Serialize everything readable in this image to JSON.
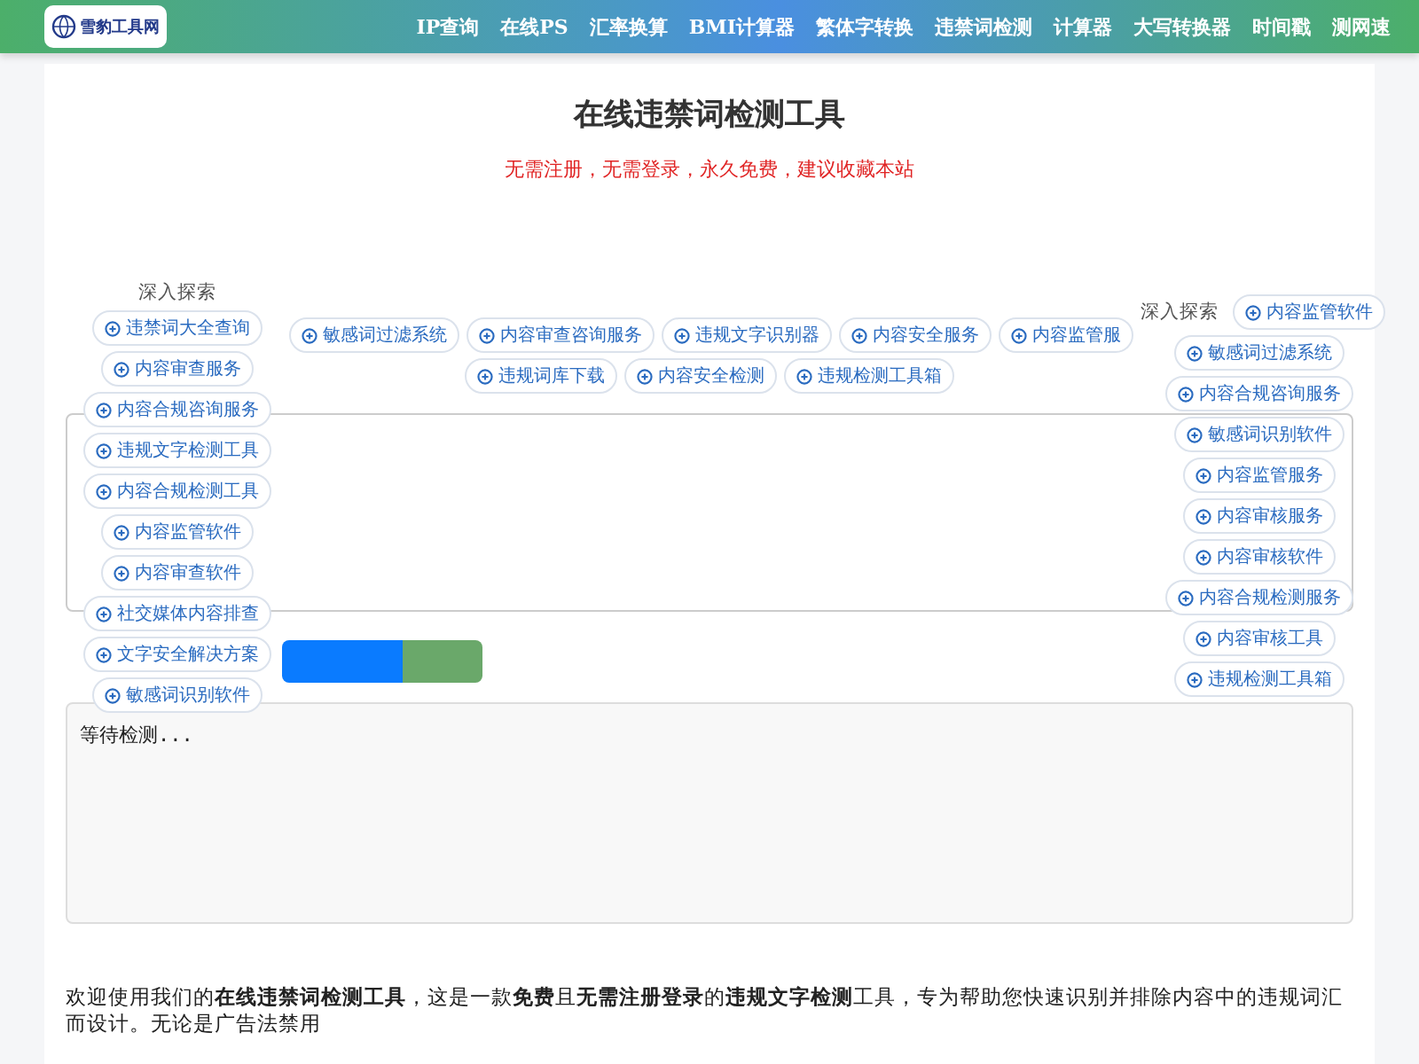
{
  "header": {
    "logo_text": "雪豹工具网",
    "nav": [
      "IP查询",
      "在线PS",
      "汇率换算",
      "BMI计算器",
      "繁体字转换",
      "违禁词检测",
      "计算器",
      "大写转换器",
      "时间戳",
      "测网速"
    ]
  },
  "title": "在线违禁词检测工具",
  "subtitle": "无需注册，无需登录，永久免费，建议收藏本站",
  "tag_rows": [
    [
      "敏感词过滤系统",
      "内容审查咨询服务",
      "违规文字识别器",
      "内容安全服务",
      "内容监管服"
    ],
    [
      "违规词库下载",
      "内容安全检测",
      "违规检测工具箱"
    ]
  ],
  "buttons": [
    {
      "kind": "primary"
    },
    {
      "kind": "secondary"
    }
  ],
  "result": {
    "text": "等待检测..."
  },
  "intro": "欢迎使用我们的**在线违禁词检测工具**，这是一款**免费**且**无需注册登录**的**违规文字检测**工具，专为帮助您快速识别并排除内容中的违规词汇而设计。无论是广告法禁用",
  "explore_left": {
    "label": "深入探索",
    "tags": [
      "违禁词大全查询",
      "内容审查服务",
      "内容合规咨询服务",
      "违规文字检测工具",
      "内容合规检测工具",
      "内容监管软件",
      "内容审查软件",
      "社交媒体内容排查",
      "文字安全解决方案",
      "敏感词识别软件"
    ]
  },
  "explore_right": {
    "label": "深入探索",
    "tags": [
      "内容监管软件",
      "敏感词过滤系统",
      "内容合规咨询服务",
      "敏感词识别软件",
      "内容监管服务",
      "内容审核服务",
      "内容审核软件",
      "内容合规检测服务",
      "内容审核工具",
      "违规检测工具箱"
    ]
  }
}
